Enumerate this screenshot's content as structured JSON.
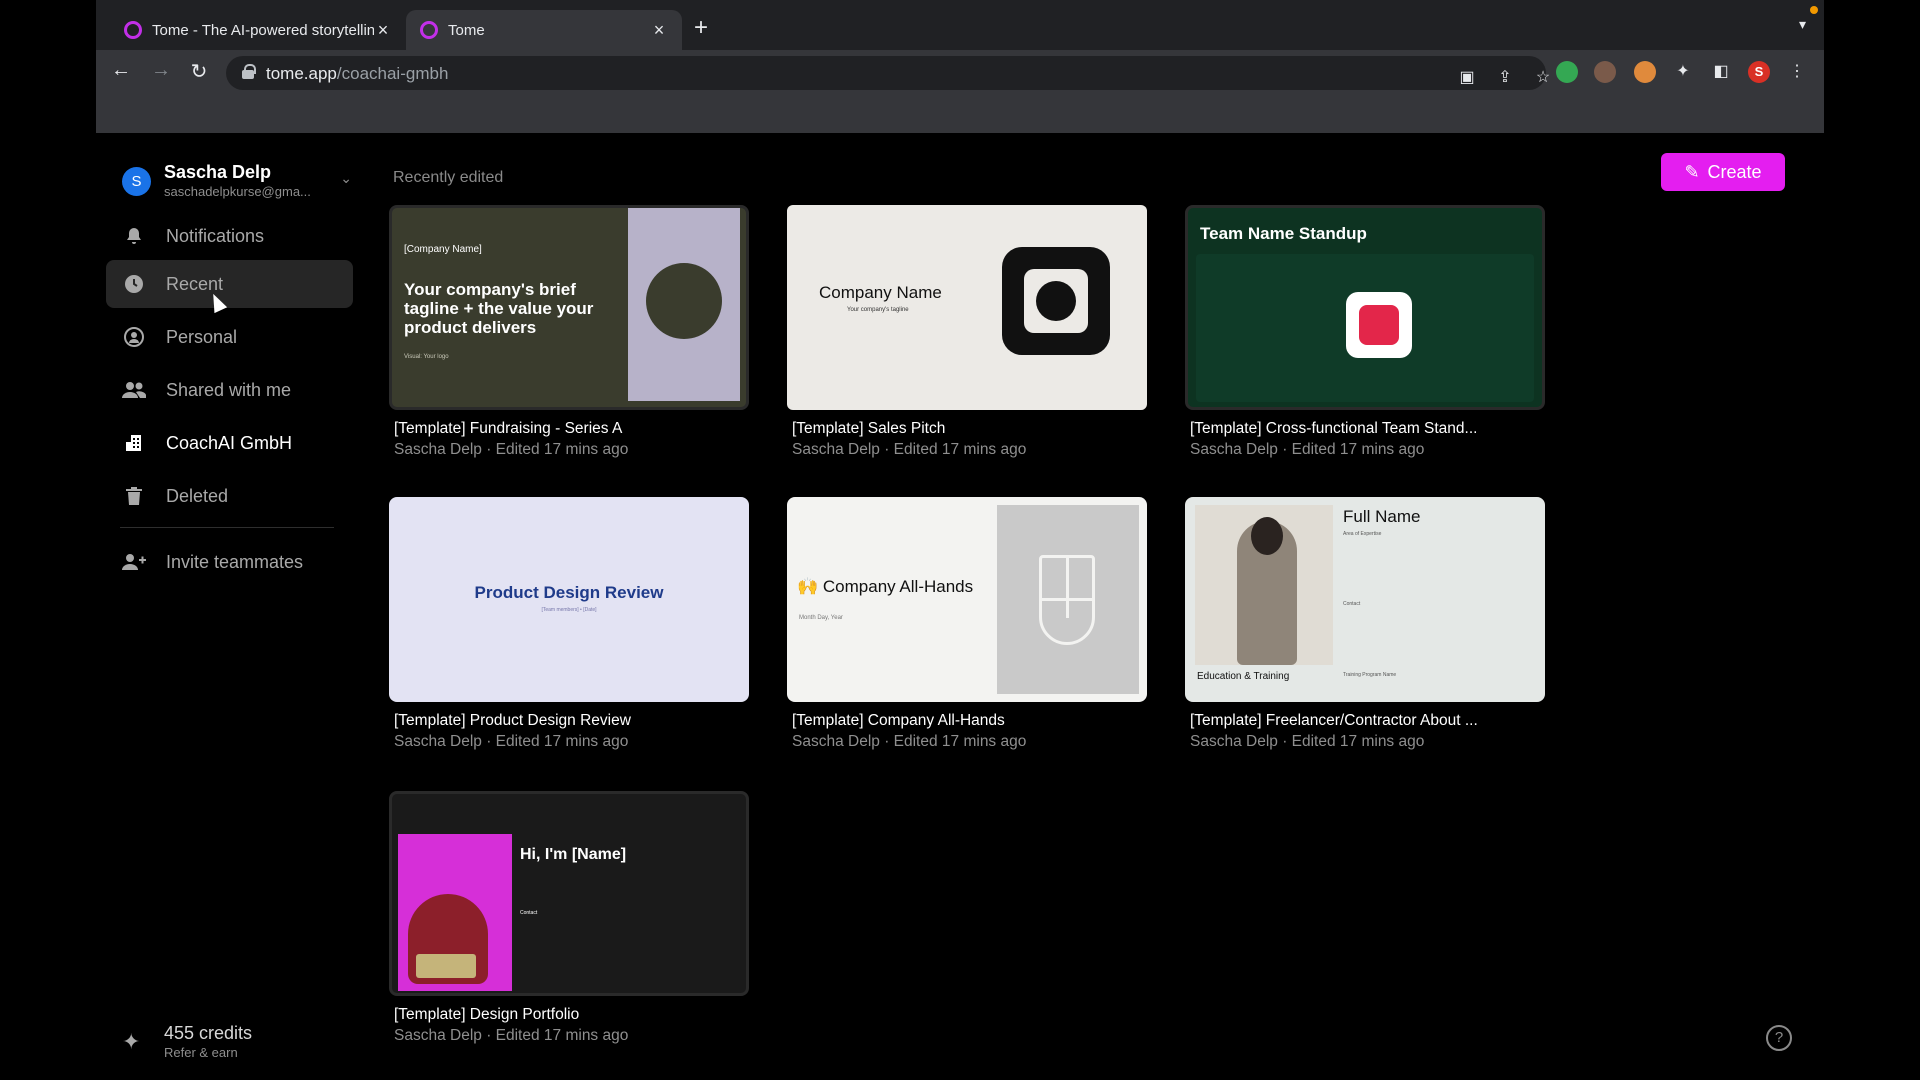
{
  "browser": {
    "tabs": [
      {
        "title": "Tome - The AI-powered storytelling format",
        "active": false
      },
      {
        "title": "Tome",
        "active": true
      }
    ],
    "url_domain": "tome.app",
    "url_path": "/coachai-gmbh",
    "profile_initial": "S"
  },
  "sidebar": {
    "user": {
      "initial": "S",
      "name": "Sascha Delp",
      "email": "saschadelpkurse@gma..."
    },
    "items": [
      {
        "label": "Notifications",
        "icon": "bell-icon"
      },
      {
        "label": "Recent",
        "icon": "clock-icon",
        "active": true
      },
      {
        "label": "Personal",
        "icon": "person-icon"
      },
      {
        "label": "Shared with me",
        "icon": "people-icon"
      },
      {
        "label": "CoachAI GmbH",
        "icon": "building-icon"
      },
      {
        "label": "Deleted",
        "icon": "trash-icon"
      }
    ],
    "invite_label": "Invite teammates",
    "credits": {
      "amount": "455 credits",
      "sub": "Refer & earn"
    }
  },
  "main": {
    "section_label": "Recently edited",
    "create_label": "Create",
    "cards": [
      {
        "title": "[Template] Fundraising - Series A",
        "meta": "Sascha Delp · Edited 17 mins ago",
        "thumb": {
          "label": "[Company Name]",
          "headline": "Your company's brief tagline + the value your product delivers",
          "small": "Visual: Your logo"
        }
      },
      {
        "title": "[Template] Sales Pitch",
        "meta": "Sascha Delp · Edited 17 mins ago",
        "thumb": {
          "headline": "Company Name",
          "small": "Your company's tagline"
        }
      },
      {
        "title": "[Template] Cross-functional Team Stand...",
        "meta": "Sascha Delp · Edited 17 mins ago",
        "thumb": {
          "headline": "Team Name Standup"
        }
      },
      {
        "title": "[Template] Product Design Review",
        "meta": "Sascha Delp · Edited 17 mins ago",
        "thumb": {
          "headline": "Product Design Review",
          "small": "[Team members] • [Date]"
        }
      },
      {
        "title": "[Template] Company All-Hands",
        "meta": "Sascha Delp · Edited 17 mins ago",
        "thumb": {
          "headline": "🙌 Company All-Hands",
          "small": "Month Day, Year"
        }
      },
      {
        "title": "[Template] Freelancer/Contractor About ...",
        "meta": "Sascha Delp · Edited 17 mins ago",
        "thumb": {
          "headline": "Full Name",
          "sub": "Area of Expertise",
          "contact": "Contact",
          "edu": "Education & Training",
          "program": "Training Program Name"
        }
      },
      {
        "title": "[Template] Design Portfolio",
        "meta": "Sascha Delp · Edited 17 mins ago",
        "thumb": {
          "headline": "Hi, I'm [Name]",
          "contact": "Contact"
        }
      }
    ]
  },
  "colors": {
    "accent": "#e41ef0",
    "background": "#000000",
    "browser_chrome": "#202124"
  }
}
